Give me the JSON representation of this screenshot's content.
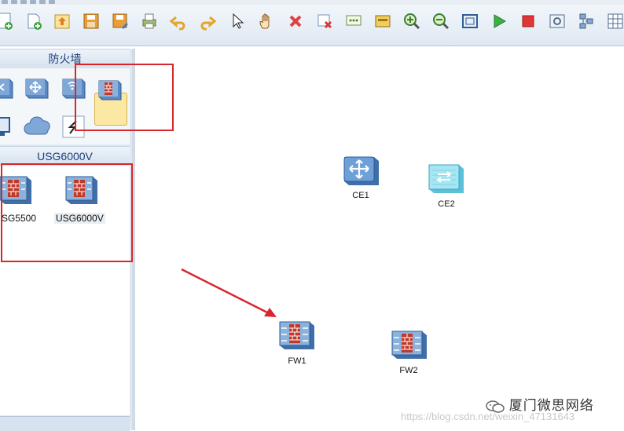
{
  "palette": {
    "section1_title": "防火墙",
    "section2_title": "USG6000V",
    "devices": [
      {
        "label": "SG5500",
        "icon": "firewall-icon"
      },
      {
        "label": "USG6000V",
        "icon": "firewall-icon"
      }
    ]
  },
  "canvas": {
    "nodes": [
      {
        "label": "CE1",
        "icon": "switch-icon"
      },
      {
        "label": "CE2",
        "icon": "switch-icon"
      },
      {
        "label": "FW1",
        "icon": "firewall-icon"
      },
      {
        "label": "FW2",
        "icon": "firewall-icon"
      }
    ]
  },
  "watermark": {
    "url_text": "https://blog.csdn.net/weixin_47131643",
    "wechat_text": "厦门微思网络"
  },
  "colors": {
    "accent_red": "#d9262c",
    "header_text": "#1a3f7a"
  }
}
